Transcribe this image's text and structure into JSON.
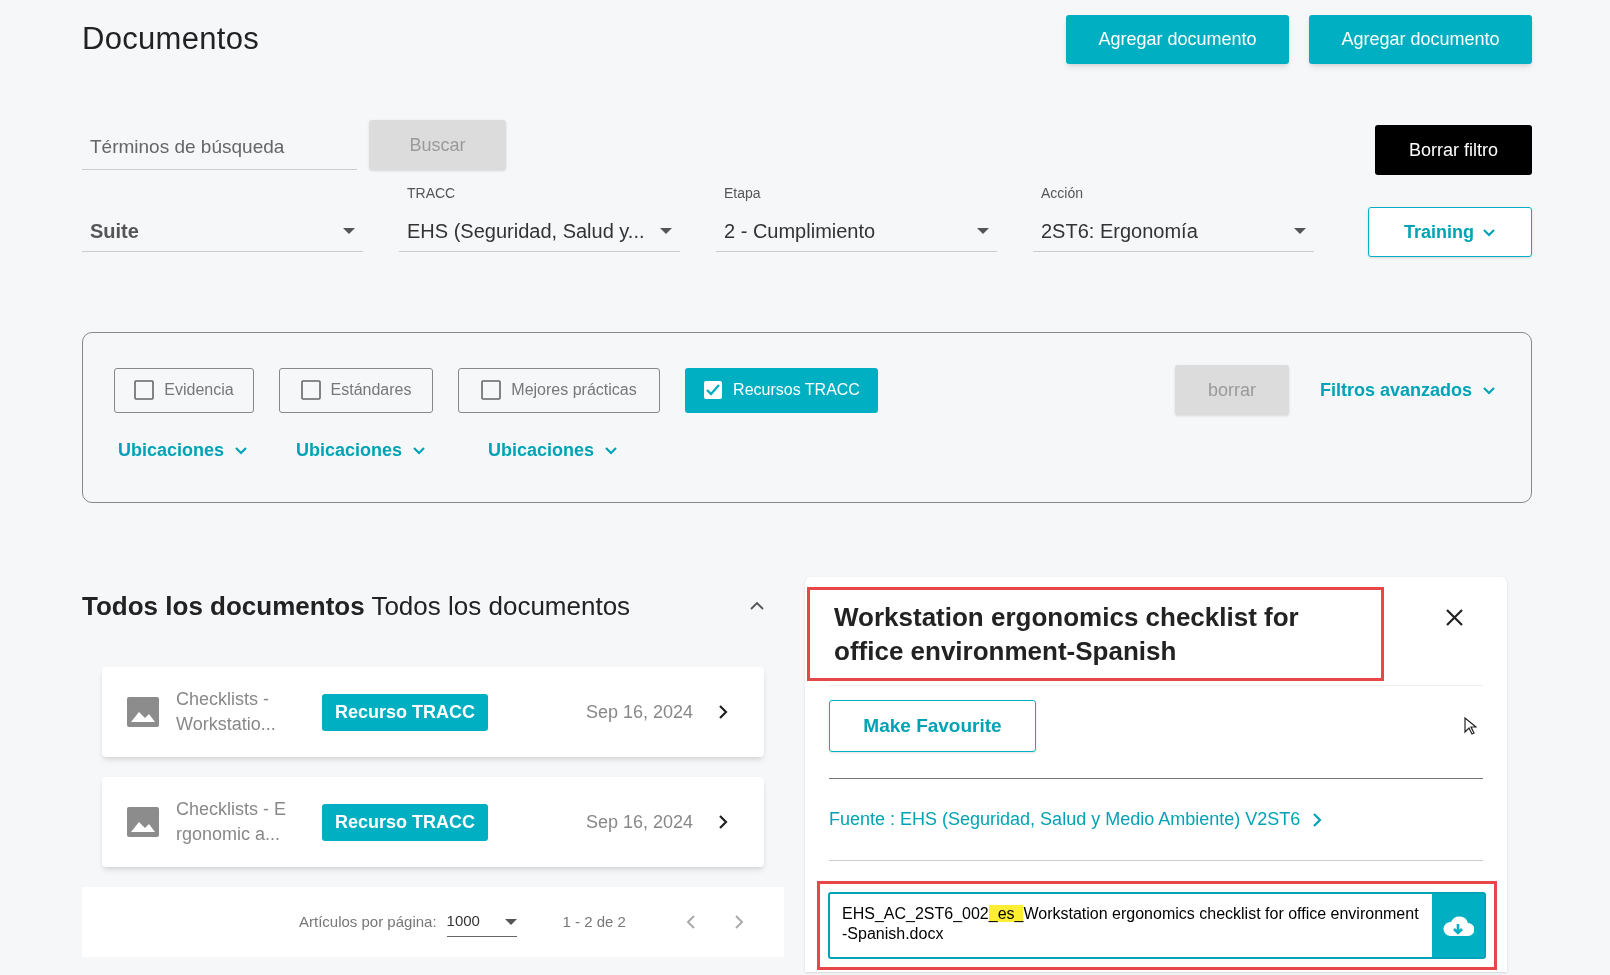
{
  "page_title": "Documentos",
  "header_buttons": [
    "Agregar documento",
    "Agregar documento"
  ],
  "search": {
    "placeholder": "Términos de búsqueda",
    "button": "Buscar",
    "disabled": true
  },
  "clear_filter_button": "Borrar filtro",
  "selects": [
    {
      "value": "Suite",
      "bold": true
    },
    {
      "label": "TRACC",
      "value": "EHS (Seguridad, Salud y...",
      "bold": false
    },
    {
      "label": "Etapa",
      "value": "2 - Cumplimiento",
      "bold": false
    },
    {
      "label": "Acción",
      "value": "2ST6: Ergonomía",
      "bold": false
    }
  ],
  "training_button": "Training",
  "filters": {
    "checkboxes": [
      {
        "label": "Evidencia",
        "checked": false
      },
      {
        "label": "Estándares",
        "checked": false
      },
      {
        "label": "Mejores prácticas",
        "checked": false
      },
      {
        "label": "Recursos TRACC",
        "checked": true
      }
    ],
    "clear_button": "borrar",
    "clear_disabled": true,
    "advanced": "Filtros avanzados",
    "locations": [
      "Ubicaciones",
      "Ubicaciones",
      "Ubicaciones"
    ]
  },
  "list": {
    "title_bold": "Todos los documentos",
    "title": "Todos los documentos",
    "expanded": true,
    "items": [
      {
        "name": "Checklists - Workstatio...",
        "tag": "Recurso TRACC",
        "date": "Sep 16, 2024"
      },
      {
        "name": "Checklists - E rgonomic a...",
        "tag": "Recurso TRACC",
        "date": "Sep 16, 2024"
      }
    ],
    "pagination": {
      "label": "Artículos por página:",
      "per_page": "1000",
      "range": "1 - 2 de 2"
    }
  },
  "detail": {
    "title": "Workstation ergonomics checklist for office environment-Spanish",
    "title_highlighted": true,
    "favourite_button": "Make Favourite",
    "source": "Fuente : EHS (Seguridad, Salud y Medio Ambiente) V2ST6",
    "file_highlighted": true,
    "file_parts": [
      {
        "text": "EHS_AC_2ST6_002",
        "highlighted": false
      },
      {
        "text": "_es_",
        "highlighted": true
      },
      {
        "text": "Workstation ergonomics checklist for office environment-Spanish.docx",
        "highlighted": false
      }
    ]
  }
}
